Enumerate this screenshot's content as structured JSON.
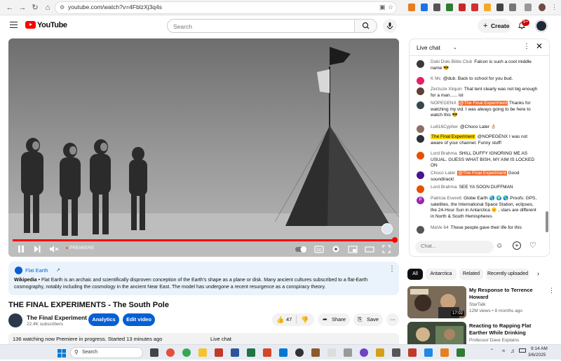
{
  "browser": {
    "url": "youtube.com/watch?v=4FblzXj3q4s"
  },
  "masthead": {
    "logo_text": "YouTube",
    "search_placeholder": "Search",
    "create_label": "Create",
    "notification_count": "9+"
  },
  "player": {
    "status_label": "PREMIERE",
    "progress_fraction": 1.0
  },
  "wikipedia": {
    "title": "Flat Earth",
    "source": "Wikipedia",
    "text": "Flat Earth is an archaic and scientifically disproven conception of the Earth's shape as a plane or disk. Many ancient cultures subscribed to a flat-Earth cosmography, notably including the cosmology in the ancient Near East. The model has undergone a recent resurgence as a conspiracy theory."
  },
  "video": {
    "title": "THE FINAL EXPERIMENTS - The South Pole",
    "channel_name": "The Final Experiment",
    "subscribers": "22.4K subscribers",
    "analytics_label": "Analytics",
    "edit_label": "Edit video",
    "likes": "47",
    "share_label": "Share",
    "save_label": "Save",
    "info_line": "136 watching now  Premiere in progress. Started 13 minutes ago",
    "live_chat_collapsed": "Live chat"
  },
  "chat": {
    "title": "Live chat",
    "input_placeholder": "Chat...",
    "messages": [
      {
        "author": "Doki Doki Bible Club",
        "text": "Falcon is such a cool middle name 😎",
        "color": "#3a3a3a"
      },
      {
        "author": "K Mc",
        "text": "@dub. Back to school for you bud.",
        "color": "#e91e63"
      },
      {
        "author": "Zerzuze Xiiquin",
        "text": "That tent clearly was not big enough for a man...... lol",
        "color": "#5d4037"
      },
      {
        "author": "NOPEGENX",
        "mention": "@The Final Experiment",
        "text": "Thanks for watching my vid. I was always going to be here to watch this 😎",
        "color": "#37474f"
      },
      {
        "author": "Lu616Cypher",
        "text": "@Choco Later 👌🏼",
        "color": "#8d6e63"
      },
      {
        "author": "The Final Experiment",
        "text": "@NOPEGENX I was not aware of your channel. Funny stuff!",
        "color": "#263238"
      },
      {
        "author": "Lord Brahma",
        "text": "SHILL DUFFY IGNORING ME AS USUAL. GUESS WHAT BISH, MY AIM IS LOCKED ON",
        "color": "#e65100"
      },
      {
        "author": "Choco Later",
        "mention": "@The Final Experiment",
        "text": "Good soundtrack!",
        "color": "#4a148c"
      },
      {
        "author": "Lord Brahma",
        "text": "SEE YA SOON DUFFMAN",
        "color": "#e65100"
      },
      {
        "author": "Patricia Everett",
        "text": "Globe Earth 🌏 🌍 🌎 Proofs: GPS, satellites, the International Space Station, eclipses, the 24-Hour Sun in Antarctica 🌞 , stars are different in North & South Hemispheres",
        "color": "#9c27b0",
        "initial": "P"
      },
      {
        "author": "MaVe 64",
        "text": "These people gave their life for this",
        "color": "#555555"
      }
    ]
  },
  "chips": [
    "All",
    "Antarctica",
    "Related",
    "Recently uploaded"
  ],
  "recommendations": [
    {
      "title": "My Response to Terrence Howard",
      "channel": "StarTalk",
      "meta": "12M views • 8 months ago",
      "duration": "17:02"
    },
    {
      "title": "Reacting to Rapping Flat Earther While Drinking",
      "channel": "Professor Dave Explains",
      "meta": "",
      "duration": ""
    }
  ],
  "taskbar": {
    "search_label": "Search",
    "time": "9:14 AM",
    "date": "3/6/2025"
  }
}
